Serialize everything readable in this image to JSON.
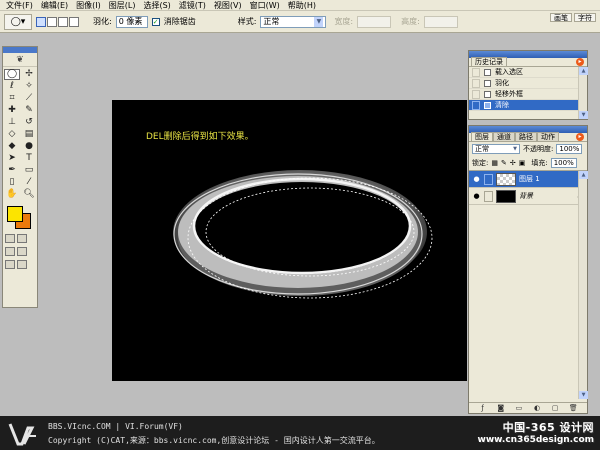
{
  "menubar": {
    "items": [
      "文件(F)",
      "编辑(E)",
      "图像(I)",
      "图层(L)",
      "选择(S)",
      "滤镜(T)",
      "视图(V)",
      "窗口(W)",
      "帮助(H)"
    ]
  },
  "options": {
    "preset_icon": "ellipse-marquee-icon",
    "feather_label": "羽化:",
    "feather_value": "0 像素",
    "antialias_label": "消除锯齿",
    "antialias_checked": true,
    "style_label": "样式:",
    "style_value": "正常",
    "width_label": "宽度:",
    "height_label": "高度:",
    "well_tabs": [
      "画笔",
      "字符"
    ]
  },
  "canvas": {
    "caption": "DEL删除后得到如下效果。",
    "background": "#000000",
    "caption_color": "#e7e244"
  },
  "toolbox": {
    "foreground_color": "#fce400",
    "background_color": "#ea7a0c"
  },
  "history": {
    "tab": "历史记录",
    "items": [
      {
        "label": "载入选区",
        "icon": "history-state-icon"
      },
      {
        "label": "羽化",
        "icon": "history-state-icon"
      },
      {
        "label": "轻移外框",
        "icon": "history-state-icon"
      },
      {
        "label": "清除",
        "icon": "history-state-icon",
        "active": true
      }
    ]
  },
  "layers": {
    "tabs": [
      "图层",
      "通道",
      "路径",
      "动作"
    ],
    "blend_mode": "正常",
    "opacity_label": "不透明度:",
    "opacity_value": "100%",
    "lock_label": "锁定:",
    "fill_label": "填充:",
    "fill_value": "100%",
    "items": [
      {
        "name": "图层 1",
        "thumb": "transparent",
        "active": true
      },
      {
        "name": "背景",
        "thumb": "black",
        "locked": true
      }
    ]
  },
  "footer": {
    "line1": "BBS.VIcnc.COM | VI.Forum(VF)",
    "line2": "Copyright (C)CAT,来源：bbs.vicnc.com,创意设计论坛 - 国内设计人第一交流平台。",
    "watermark1": "中国-365 设计网",
    "watermark2": "www.cn365design.com"
  }
}
